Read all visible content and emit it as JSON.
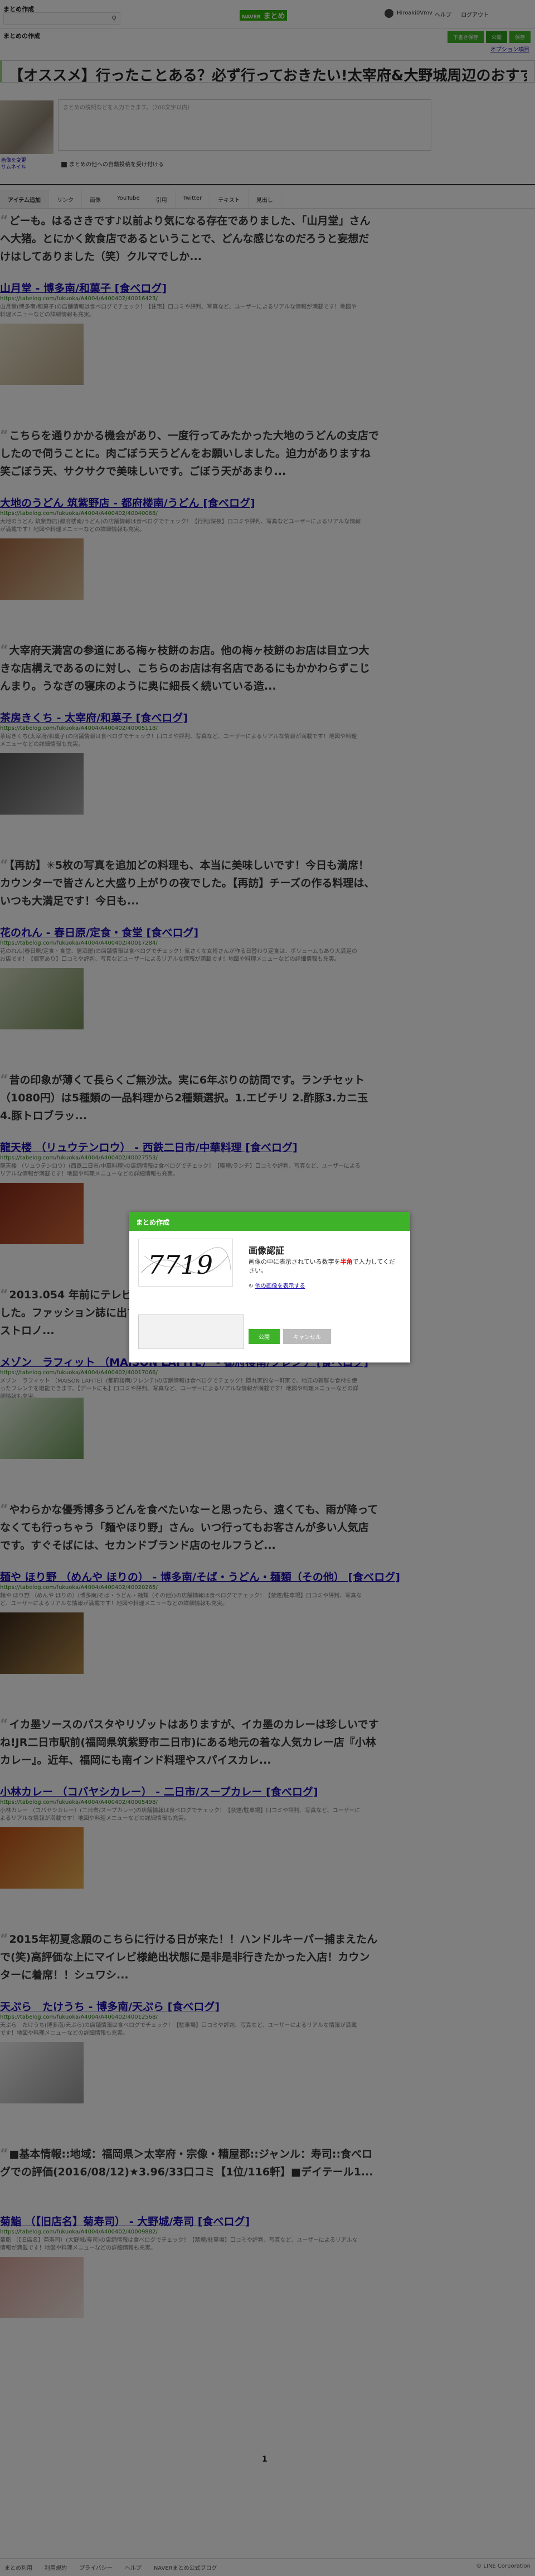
{
  "header": {
    "site_title": "まとめ作成",
    "brand_logo": "NAVER",
    "brand_word": "まとめ",
    "user_name": "Hiroaki0Vmv",
    "links": [
      "ヘルプ",
      "ログアウト"
    ]
  },
  "editor": {
    "title_label": "まとめの作成",
    "buttons": {
      "preview": "下書き保存",
      "publish": "公開",
      "save": "保存"
    },
    "option_link": "オプション項目",
    "title_value": "【オススメ】行ったことある？必ず行っておきたい!太宰府&大野城周辺のおすすめグルメ店",
    "desc_placeholder": "まとめの説明などを入力できます。（200文字以内）",
    "thumb_caption": [
      "画像を変更",
      "サムネイル"
    ],
    "checkbox_label": "まとめの他への自動投稿を受け付ける"
  },
  "tabs": [
    "アイテム追加",
    "リンク",
    "画像",
    "YouTube",
    "引用",
    "Twitter",
    "テキスト",
    "見出し"
  ],
  "items": [
    {
      "quote": "どーも。はるさきです♪以前より気になる存在でありました、「山月堂」さんへ大猪。とにかく飲食店であるということで、どんな感じなのだろうと妄想だけはしてありました（笑）クルマでしか...",
      "title": "山月堂 - 博多南/和菓子 [食べログ]",
      "url": "https://tabelog.com/fukuoka/A4004/A400402/40016423/",
      "desc": "山月堂(博多南/和菓子)の店舗情報は食べログでチェック！【住宅】口コミや評判、写真など、ユーザーによるリアルな情報が満載です！地図や料理メニューなどの詳細情報も充実。"
    },
    {
      "quote": "こちらを通りかかる機会があり、一度行ってみたかった大地のうどんの支店でしたので伺うことに。肉ごぼう天うどんをお願いしました。迫力がありますね笑ごぼう天、サクサクで美味しいです。ごぼう天があまり...",
      "title": "大地のうどん 筑紫野店 - 都府楼南/うどん [食べログ]",
      "url": "https://tabelog.com/fukuoka/A4004/A400402/40040068/",
      "desc": "大地のうどん 筑紫野店(都府楼南/うどん)の店舗情報は食べログでチェック！【行列/深夜】口コミや評判、写真などユーザーによるリアルな情報が満載です！地図や料理メニューなどの詳細情報も充実。"
    },
    {
      "quote": "大宰府天満宮の参道にある梅ヶ枝餅のお店。他の梅ヶ枝餅のお店は目立つ大きな店構えであるのに対し、こちらのお店は有名店であるにもかかわらずこじんまり。うなぎの寝床のように奥に細長く続いている造...",
      "title": "茶房きくち - 太宰府/和菓子 [食べログ]",
      "url": "https://tabelog.com/fukuoka/A4004/A400402/40005118/",
      "desc": "茶房きくち(太宰府/和菓子)の店舗情報は食べログでチェック！口コミや評判、写真など、ユーザーによるリアルな情報が満載です！地図や料理メニューなどの詳細情報も充実。"
    },
    {
      "quote": "【再訪】✳5枚の写真を追加どの料理も、本当に美味しいです！今日も満席！カウンターで皆さんと大盛り上がりの夜でした。【再訪】チーズの作る料理は、いつも大満足です！今日も...",
      "title": "花のれん - 春日原/定食・食堂 [食べログ]",
      "url": "https://tabelog.com/fukuoka/A4004/A400402/40017284/",
      "desc": "花のれん(春日原/定食・食堂、居酒屋)の店舗情報は食べログでチェック！気さくな女将さんが作る日替わり定食は、ボリュームもあり大満足のお店です！【個室あり】口コミや評判、写真などユーザーによるリアルな情報が満載です！地図や料理メニューなどの詳細情報も充実。"
    },
    {
      "quote": "昔の印象が薄くて長らくご無沙汰。実に6年ぶりの訪問です。ランチセット（1080円）は5種類の一品料理から2種類選択。1.エビチリ 2.酢豚3.カニ玉4.豚トロブラッ...",
      "title": "龍天楼 （リュウテンロウ） - 西鉄二日市/中華料理 [食べログ]",
      "url": "https://tabelog.com/fukuoka/A4004/A400402/40027553/",
      "desc": "龍天楼 （リュウテンロウ）(西鉄二日市/中華料理)の店舗情報は食べログでチェック！【喫煙/ランチ】口コミや評判、写真など、ユーザーによるリアルな情報が満載です！地図や料理メニューなどの詳細情報も充実。"
    },
    {
      "quote": "2013.054 年前にテレビで見て気になり、時間かかってようやく訪問できました。ファッション誌に出てきそうな店構えで、なんと本店はまだ九州ではガストロノ...",
      "title": "メゾン　ラフィット （MAISON LAFITE） - 都府楼南/フレンチ [食べログ]",
      "url": "https://tabelog.com/fukuoka/A4004/A400402/40017066/",
      "desc": "メゾン　ラフィット （MAISON LAFITE）(都府楼南/フレンチ)の店舗情報は食べログでチェック！隠れ家的な一軒家で、地元の新鮮な食材を使ったフレンチを堪能できます。【デートにも】口コミや評判、写真など、ユーザーによるリアルな情報が満載です！地図や料理メニューなどの詳細情報も充実。"
    },
    {
      "quote": "やわらかな優秀博多うどんを食べたいなーと思ったら、遠くても、雨が降ってなくても行っちゃう「麺やほり野」さん。いつ行ってもお客さんが多い人気店です。すぐそばには、セカンドブランド店のセルフうど...",
      "title": "麺や ほり野 （めんや ほりの） - 博多南/そば・うどん・麺類（その他） [食べログ]",
      "url": "https://tabelog.com/fukuoka/A4004/A400402/40020265/",
      "desc": "麺や ほり野 （めんや ほりの）(博多南/そば・うどん・麺類（その他）)の店舗情報は食べログでチェック！【禁煙/駐車場】口コミや評判、写真など、ユーザーによるリアルな情報が満載です！地図や料理メニューなどの詳細情報も充実。"
    },
    {
      "quote": "イカ墨ソースのパスタやリゾットはありますが、イカ墨のカレーは珍しいですね!JR二日市駅前(福岡県筑紫野市二日市)にある地元の着な人気カレー店『小林カレー』。近年、福岡にも南インド料理やスパイスカレ...",
      "title": "小林カレー （コバヤシカレー） - 二日市/スープカレー [食べログ]",
      "url": "https://tabelog.com/fukuoka/A4004/A400402/40005498/",
      "desc": "小林カレー （コバヤシカレー）(二日市/スープカレー)の店舗情報は食べログでチェック！【禁煙/駐車場】口コミや評判、写真など、ユーザーによるリアルな情報が満載です！地図や料理メニューなどの詳細情報も充実。"
    },
    {
      "quote": "2015年初夏念願のこちらに行ける日が来た！！ハンドルキーパー捕まえたんで(笑)高評価な上にマイレビ様絶出状態に是非是非行きたかった入店！カウンターに着席！！シュワシ...",
      "title": "天ぷら　たけうち - 博多南/天ぷら [食べログ]",
      "url": "https://tabelog.com/fukuoka/A4004/A400402/40012568/",
      "desc": "天ぷら　たけうち(博多南/天ぷら)の店舗情報は食べログでチェック！【駐車場】口コミや評判、写真など、ユーザーによるリアルな情報が満載です！地図や料理メニューなどの詳細情報も充実。"
    },
    {
      "quote": "■基本情報::地域：福岡県＞太宰府・宗像・糟屋郡::ジャンル：寿司::食べログでの評価(2016/08/12)★3.96/33口コミ【1位/116軒】■デイテール1...",
      "title": "菊鮨 （【旧店名】菊寿司） - 大野城/寿司 [食べログ]",
      "url": "https://tabelog.com/fukuoka/A4004/A400402/40009882/",
      "desc": "菊鮨 （【旧店名】菊寿司）(大野城/寿司)の店舗情報は食べログでチェック！【禁煙/駐車場】口コミや評判、写真など、ユーザーによるリアルな情報が満載です！地図や料理メニューなどの詳細情報も充実。"
    }
  ],
  "pager": {
    "current": "1"
  },
  "footer": {
    "links": [
      "まとめ利用",
      "利用規約",
      "プライバシー",
      "ヘルプ",
      "NAVERまとめ公式ブログ"
    ],
    "copyright": "© LINE Corporation"
  },
  "modal": {
    "header": "まとめ作成",
    "captcha_code": "7719",
    "title": "画像認証",
    "text_before": "画像の中に表示されている数字を",
    "text_red": "半角",
    "text_after": "で入力してください。",
    "refresh": "他の画像を表示する",
    "ok": "公開",
    "cancel": "キャンセル"
  }
}
